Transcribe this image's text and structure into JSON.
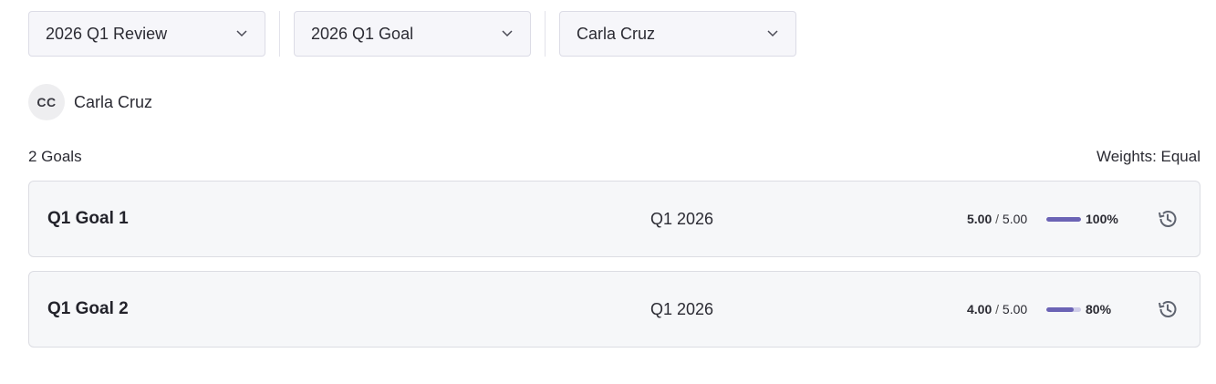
{
  "filters": [
    {
      "value": "2026 Q1 Review",
      "icon": "chevron-down-icon"
    },
    {
      "value": "2026 Q1 Goal",
      "icon": "chevron-down-icon"
    },
    {
      "value": "Carla Cruz",
      "icon": "chevron-down-icon"
    }
  ],
  "person": {
    "initials": "CC",
    "name": "Carla Cruz"
  },
  "summary": {
    "goals_count": "2 Goals",
    "weights": "Weights: Equal"
  },
  "goals": [
    {
      "title": "Q1 Goal 1",
      "period": "Q1 2026",
      "earned": "5.00",
      "separator": "/",
      "max": "5.00",
      "percent_label": "100%",
      "progress": 1.0
    },
    {
      "title": "Q1 Goal 2",
      "period": "Q1 2026",
      "earned": "4.00",
      "separator": "/",
      "max": "5.00",
      "percent_label": "80%",
      "progress": 0.8
    }
  ],
  "colors": {
    "accent": "#6b63b5",
    "track": "#cfcde9",
    "card_bg": "#f6f7f9",
    "icon": "#5f6470"
  }
}
